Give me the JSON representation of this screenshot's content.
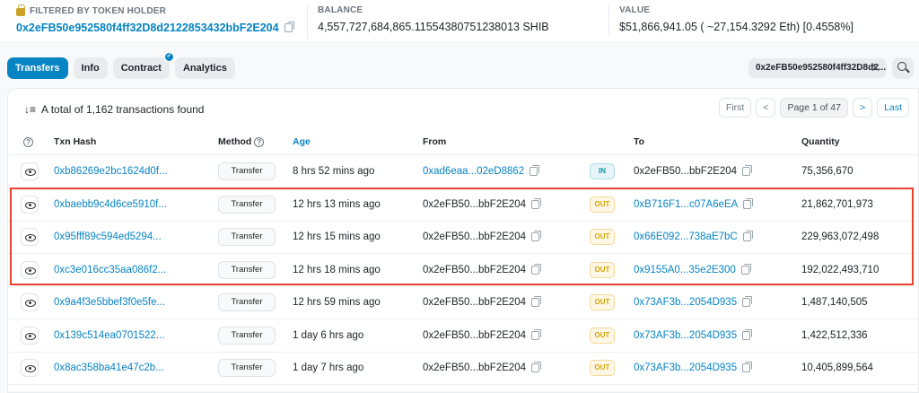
{
  "header": {
    "holder_label": "FILTERED BY TOKEN HOLDER",
    "holder_address": "0x2eFB50e952580f4ff32D8d2122853432bbF2E204",
    "balance_label": "BALANCE",
    "balance_value": "4,557,727,684,865.11554380751238013 SHIB",
    "value_label": "VALUE",
    "value_value": "$51,866,941.05 ( ~27,154.3292 Eth) [0.4558%]"
  },
  "tabs": [
    {
      "label": "Transfers",
      "active": true
    },
    {
      "label": "Info"
    },
    {
      "label": "Contract"
    },
    {
      "label": "Analytics"
    }
  ],
  "filter": {
    "address": "0x2eFB50e952580f4ff32D8d2..."
  },
  "summary": {
    "text": "A total of 1,162 transactions found"
  },
  "pager": {
    "first": "First",
    "prev": "<",
    "page_info": "Page 1 of 47",
    "next": ">",
    "last": "Last"
  },
  "table": {
    "headers": {
      "txn_hash": "Txn Hash",
      "method": "Method",
      "age": "Age",
      "from": "From",
      "to": "To",
      "quantity": "Quantity"
    },
    "rows": [
      {
        "hash": "0xb86269e2bc1624d0f...",
        "method": "Transfer",
        "age": "8 hrs 52 mins ago",
        "from": "0xad6eaa...02eD8862",
        "dir": "IN",
        "to": "0x2eFB50...bbF2E204",
        "qty": "75,356,670"
      },
      {
        "hash": "0xbaebb9c4d6ce5910f...",
        "method": "Transfer",
        "age": "12 hrs 13 mins ago",
        "from": "0x2eFB50...bbF2E204",
        "dir": "OUT",
        "to": "0xB716F1...c07A6eEA",
        "qty": "21,862,701,973"
      },
      {
        "hash": "0x95fff89c594ed5294...",
        "method": "Transfer",
        "age": "12 hrs 15 mins ago",
        "from": "0x2eFB50...bbF2E204",
        "dir": "OUT",
        "to": "0x66E092...738aE7bC",
        "qty": "229,963,072,498"
      },
      {
        "hash": "0xc3e016cc35aa086f2...",
        "method": "Transfer",
        "age": "12 hrs 18 mins ago",
        "from": "0x2eFB50...bbF2E204",
        "dir": "OUT",
        "to": "0x9155A0...35e2E300",
        "qty": "192,022,493,710"
      },
      {
        "hash": "0x9a4f3e5bbef3f0e5fe...",
        "method": "Transfer",
        "age": "12 hrs 59 mins ago",
        "from": "0x2eFB50...bbF2E204",
        "dir": "OUT",
        "to": "0x73AF3b...2054D935",
        "qty": "1,487,140,505"
      },
      {
        "hash": "0x139c514ea0701522...",
        "method": "Transfer",
        "age": "1 day 6 hrs ago",
        "from": "0x2eFB50...bbF2E204",
        "dir": "OUT",
        "to": "0x73AF3b...2054D935",
        "qty": "1,422,512,336"
      },
      {
        "hash": "0x8ac358ba41e47c2b...",
        "method": "Transfer",
        "age": "1 day 7 hrs ago",
        "from": "0x2eFB50...bbF2E204",
        "dir": "OUT",
        "to": "0x73AF3b...2054D935",
        "qty": "10,405,899,564"
      }
    ]
  },
  "colors": {
    "accent": "#0784c3",
    "highlight": "#e8432e",
    "in": "#0a96a8",
    "out": "#d4a500"
  }
}
